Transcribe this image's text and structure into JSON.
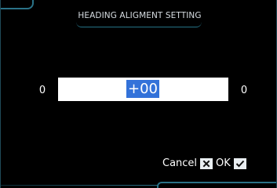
{
  "dialog": {
    "title": "HEADING ALIGMENT SETTING"
  },
  "slider": {
    "min_label": "0",
    "max_label": "0",
    "value": "+00"
  },
  "actions": {
    "cancel_label": "Cancel",
    "cancel_icon": "close-icon",
    "ok_label": "OK",
    "ok_icon": "check-icon"
  },
  "colors": {
    "background": "#000000",
    "accent": "#4fc6e4",
    "selection": "#3372d9",
    "field": "#ffffff"
  }
}
